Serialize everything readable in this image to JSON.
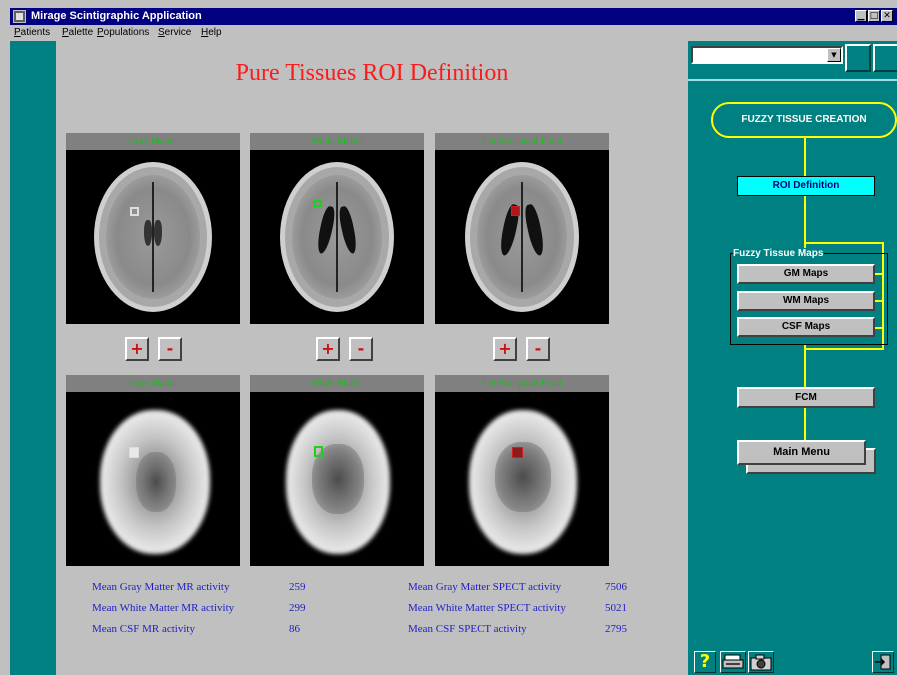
{
  "window": {
    "title": "Mirage Scintigraphic Application",
    "minimize": "▁",
    "maximize": "□",
    "close": "✕"
  },
  "menu": [
    "Patients",
    "Palette",
    "Populations",
    "Service",
    "Help"
  ],
  "page_title": "Pure Tissues ROI Definition",
  "mr_panels": [
    {
      "label": "Gray Matter",
      "roi_color": "#dddddd"
    },
    {
      "label": "White Matter",
      "roi_color": "#22cc22"
    },
    {
      "label": "Cerebrospinal Fluid",
      "roi_color": "#cc2020"
    }
  ],
  "spect_panels": [
    {
      "label": "Gray Matter",
      "roi_color": "#dddddd"
    },
    {
      "label": "White Matter",
      "roi_color": "#22cc22"
    },
    {
      "label": "Cerebrospinal Fluid",
      "roi_color": "#cc2020"
    }
  ],
  "zoom_buttons": {
    "plus": "+",
    "minus": "-"
  },
  "stats": {
    "mr": [
      {
        "label": "Mean Gray Matter MR activity",
        "value": "259"
      },
      {
        "label": "Mean White Matter MR activity",
        "value": "299"
      },
      {
        "label": "Mean CSF MR activity",
        "value": "86"
      }
    ],
    "spect": [
      {
        "label": "Mean Gray Matter SPECT activity",
        "value": "7506"
      },
      {
        "label": "Mean White Matter SPECT activity",
        "value": "5021"
      },
      {
        "label": "Mean CSF SPECT activity",
        "value": "2795"
      }
    ]
  },
  "right_panel": {
    "dropdown_value": "",
    "dropdown_arrow": "▼",
    "fuzzy_title": "FUZZY TISSUE CREATION",
    "roi_definition": "ROI Definition",
    "group_label": "Fuzzy Tissue Maps",
    "map_buttons": [
      "GM Maps",
      "WM Maps",
      "CSF Maps"
    ],
    "fcm": "FCM",
    "main_menu": "Main Menu",
    "help_icon": "?"
  },
  "colors": {
    "teal": "#008080",
    "title_red": "#ff1a1a",
    "label_green": "#13c213",
    "stat_blue": "#2020c8",
    "flow_yellow": "#ffff00",
    "roi_cyan": "#00ffff"
  }
}
